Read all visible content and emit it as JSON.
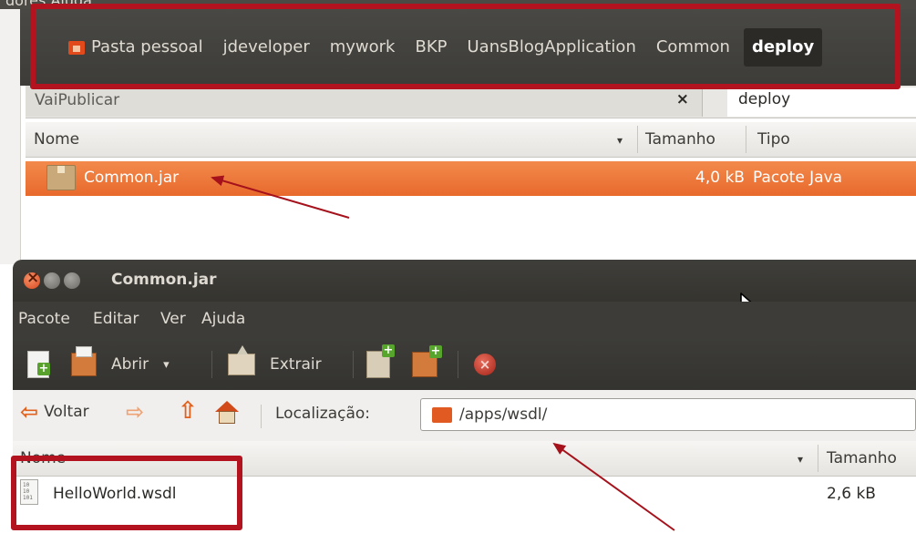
{
  "top_window": {
    "menu_fragment": "dores  Ajuda",
    "pathbar": [
      "Pasta pessoal",
      "jdeveloper",
      "mywork",
      "BKP",
      "UansBlogApplication",
      "Common",
      "deploy"
    ],
    "tabs": [
      {
        "label": "VaiPublicar",
        "close": "×"
      },
      {
        "label": "deploy"
      }
    ],
    "columns": {
      "name": "Nome",
      "sort_arrow": "▾",
      "size": "Tamanho",
      "type": "Tipo"
    },
    "rows": [
      {
        "name": "Common.jar",
        "size": "4,0 kB",
        "type": "Pacote Java",
        "selected": true
      }
    ],
    "selection_color": "#ea7135"
  },
  "archive_window": {
    "title": "Common.jar",
    "menu": [
      "Pacote",
      "Editar",
      "Ver",
      "Ajuda"
    ],
    "toolbar": {
      "open_label": "Abrir",
      "open_dropdown": "▾",
      "extract_label": "Extrair"
    },
    "location": {
      "back_label": "Voltar",
      "label": "Localização:",
      "path": "/apps/wsdl/"
    },
    "columns": {
      "name": "Nome",
      "sort_arrow": "▾",
      "size": "Tamanho"
    },
    "rows": [
      {
        "name": "HelloWorld.wsdl",
        "size": "2,6 kB",
        "icon_text": "10\n10\n101"
      }
    ]
  },
  "annotation_color": "#b3121f"
}
